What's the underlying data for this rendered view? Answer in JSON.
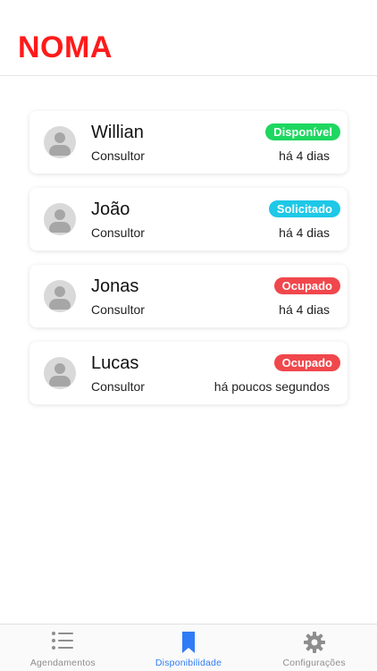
{
  "app": {
    "logo": "NOMA",
    "accent": "#ff1a1a"
  },
  "consultants": [
    {
      "name": "Willian",
      "role": "Consultor",
      "status": "Disponível",
      "status_color": "#1ed760",
      "time": "há 4 dias"
    },
    {
      "name": "João",
      "role": "Consultor",
      "status": "Solicitado",
      "status_color": "#1ec8e6",
      "time": "há 4 dias"
    },
    {
      "name": "Jonas",
      "role": "Consultor",
      "status": "Ocupado",
      "status_color": "#f0474c",
      "time": "há 4 dias"
    },
    {
      "name": "Lucas",
      "role": "Consultor",
      "status": "Ocupado",
      "status_color": "#f0474c",
      "time": "há poucos segundos"
    }
  ],
  "tabbar": {
    "tabs": [
      {
        "label": "Agendamentos",
        "icon": "list-icon",
        "active": false
      },
      {
        "label": "Disponibilidade",
        "icon": "bookmark-icon",
        "active": true
      },
      {
        "label": "Configurações",
        "icon": "gear-icon",
        "active": false
      }
    ],
    "active_color": "#2f7cf6",
    "inactive_color": "#8e8e8e"
  }
}
